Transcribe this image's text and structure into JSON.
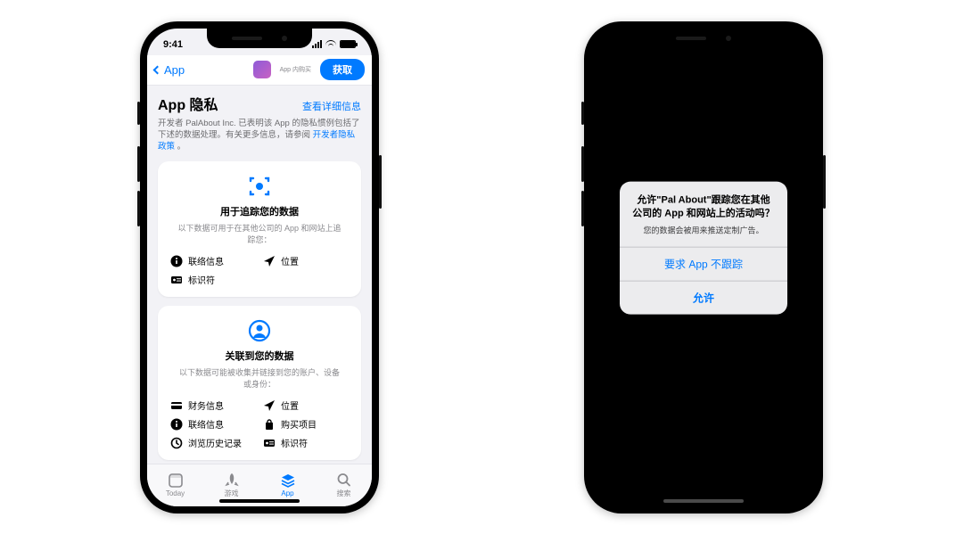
{
  "leftPhone": {
    "status": {
      "time": "9:41"
    },
    "nav": {
      "back": "App",
      "iap": "App 内购买",
      "get": "获取"
    },
    "privacy": {
      "title": "App 隐私",
      "details": "查看详细信息",
      "desc_prefix": "开发者 PalAbout Inc. 已表明该 App 的隐私惯例包括了下述的数据处理。有关更多信息，请参阅",
      "desc_link": "开发者隐私政策",
      "desc_suffix": "。"
    },
    "card1": {
      "title": "用于追踪您的数据",
      "subtitle": "以下数据可用于在其他公司的 App 和网站上追踪您：",
      "items": [
        {
          "icon": "info-icon",
          "label": "联络信息"
        },
        {
          "icon": "location-icon",
          "label": "位置"
        },
        {
          "icon": "id-icon",
          "label": "标识符"
        }
      ]
    },
    "card2": {
      "title": "关联到您的数据",
      "subtitle": "以下数据可能被收集并链接到您的账户、设备或身份：",
      "items": [
        {
          "icon": "card-icon",
          "label": "财务信息"
        },
        {
          "icon": "location-icon",
          "label": "位置"
        },
        {
          "icon": "info-icon",
          "label": "联络信息"
        },
        {
          "icon": "bag-icon",
          "label": "购买项目"
        },
        {
          "icon": "history-icon",
          "label": "浏览历史记录"
        },
        {
          "icon": "id-icon",
          "label": "标识符"
        }
      ]
    },
    "tabs": [
      {
        "label": "Today",
        "active": false
      },
      {
        "label": "游戏",
        "active": false
      },
      {
        "label": "App",
        "active": true
      },
      {
        "label": "搜索",
        "active": false
      }
    ]
  },
  "rightPhone": {
    "alert": {
      "title": "允许\"Pal About\"跟踪您在其他公司的 App 和网站上的活动吗？",
      "message": "您的数据会被用来推送定制广告。",
      "deny": "要求 App 不跟踪",
      "allow": "允许"
    }
  }
}
